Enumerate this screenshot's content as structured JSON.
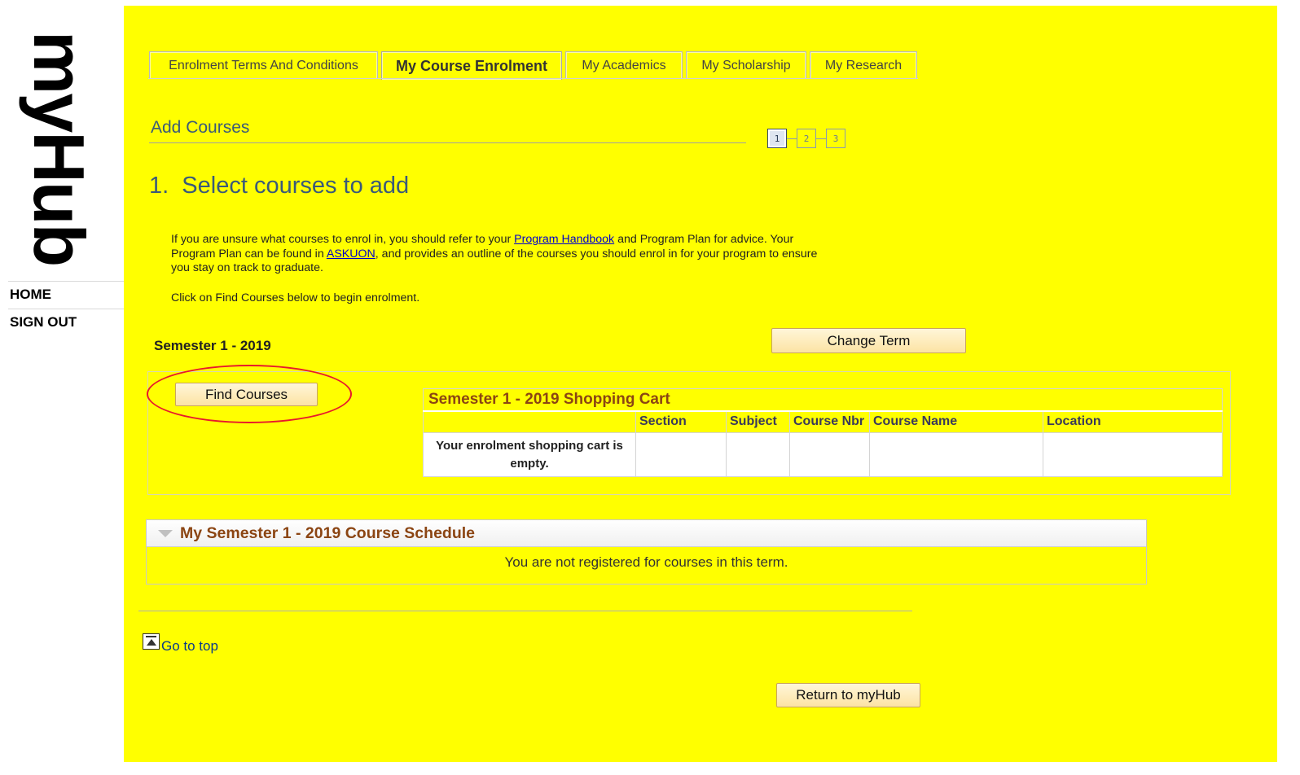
{
  "sidebar": {
    "logo": "myHub",
    "home": "HOME",
    "sign_out": "SIGN OUT"
  },
  "tabs": [
    {
      "label": "Enrolment Terms And Conditions",
      "active": false
    },
    {
      "label": "My Course Enrolment",
      "active": true
    },
    {
      "label": "My Academics",
      "active": false
    },
    {
      "label": "My Scholarship",
      "active": false
    },
    {
      "label": "My Research",
      "active": false
    }
  ],
  "page": {
    "section_title": "Add Courses",
    "steps": [
      "1",
      "2",
      "3"
    ],
    "active_step": 1,
    "heading": "1.  Select courses to add",
    "intro_part1": "If you are unsure what courses to enrol in, you should refer to your ",
    "intro_link1": "Program Handbook",
    "intro_part2": " and Program Plan for advice. Your Program Plan can be found in ",
    "intro_link2": "ASKUON",
    "intro_part3": ", and provides an outline of the courses you should enrol in for your program to ensure you stay on track to graduate.",
    "click_instruction": "Click on Find Courses below to begin enrolment.",
    "term_label": "Semester 1 - 2019",
    "change_term_button": "Change Term",
    "find_courses_button": "Find Courses"
  },
  "cart": {
    "title": "Semester 1 - 2019 Shopping Cart",
    "columns": [
      "",
      "Section",
      "Subject",
      "Course Nbr",
      "Course Name",
      "Location"
    ],
    "empty_message": "Your enrolment shopping cart is empty."
  },
  "schedule": {
    "title": "My Semester 1 - 2019 Course Schedule",
    "message": "You are not registered for courses in this term."
  },
  "footer": {
    "go_to_top": "Go to top",
    "return_button": "Return to myHub"
  },
  "colors": {
    "background": "#ffff00",
    "heading": "#3a5a7a",
    "section_title": "#8b4513",
    "highlight_circle": "#e8192c",
    "link": "#0000cc"
  }
}
